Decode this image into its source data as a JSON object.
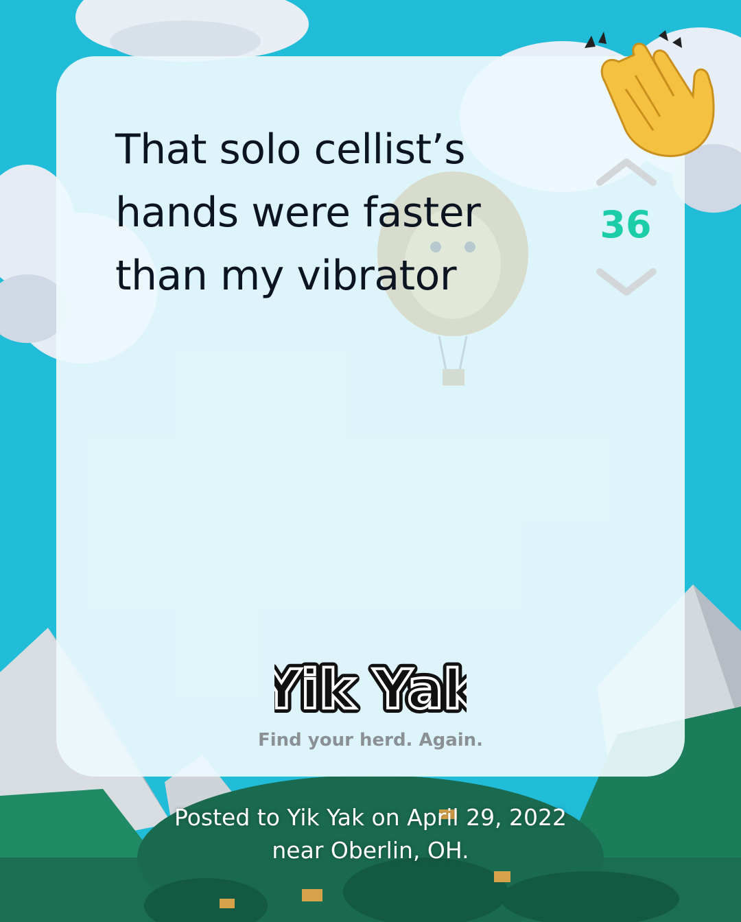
{
  "post": {
    "text": "That solo cellist’s hands were faster than my vibrator",
    "vote_count": "36"
  },
  "icons": {
    "upvote": "chevron-up-icon",
    "downvote": "chevron-down-icon",
    "reaction": "clapping-hands-icon",
    "decor_left": "cloud-icon",
    "decor_right": "cloud-icon"
  },
  "brand": {
    "logo_text": "Yik Yak",
    "tagline": "Find your herd. Again."
  },
  "caption": {
    "line1": "Posted to Yik Yak on April 29, 2022",
    "line2": "near Oberlin, OH."
  },
  "colors": {
    "background": "#21bcd8",
    "card": "#ecf9fd",
    "vote_count": "#1ccdaa",
    "text": "#0b1420",
    "tagline": "#8a9094"
  }
}
